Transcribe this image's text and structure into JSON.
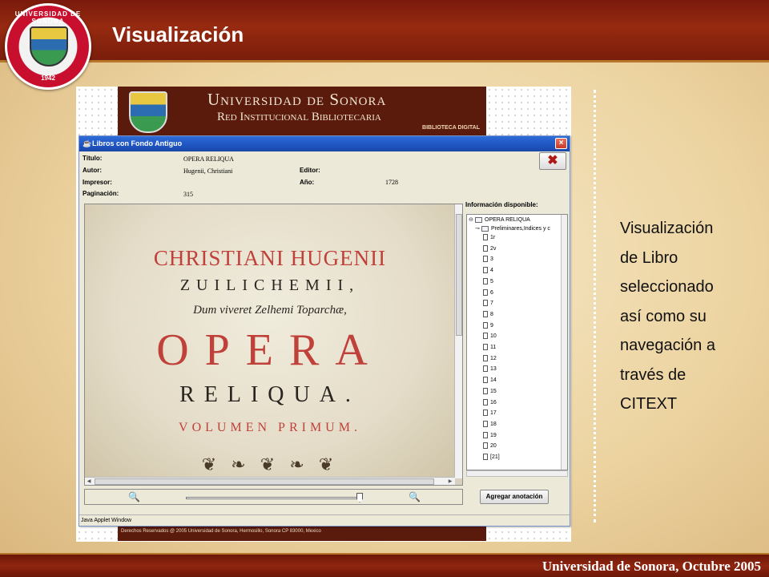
{
  "slide": {
    "title": "Visualización",
    "footer": "Universidad de Sonora, Octubre 2005",
    "seal_top": "UNIVERSIDAD DE SONORA",
    "seal_year": "1942",
    "caption_lines": [
      "Visualización",
      "de Libro",
      "seleccionado",
      "así como su",
      "navegación a",
      "través de",
      "CITEXT"
    ]
  },
  "banner": {
    "title": "Universidad de Sonora",
    "subtitle": "Red Institucional Bibliotecaria",
    "badge": "BIBLIOTECA DIGITAL",
    "copyright": "Derechos Reservados @ 2005 Universidad de Sonora, Hermosillo, Sonora CP 83000, Mexico"
  },
  "applet": {
    "window_title": "Libros con Fondo Antiguo",
    "status": "Java Applet Window",
    "close_glyph": "✖",
    "meta": {
      "titulo_label": "Título:",
      "titulo_value": "OPERA RELIQUA",
      "autor_label": "Autor:",
      "autor_value": "Hugenii, Christiani",
      "impresor_label": "Impresor:",
      "paginacion_label": "Paginación:",
      "paginacion_value": "315",
      "editor_label": "Editor:",
      "anio_label": "Año:",
      "anio_value": "1728"
    },
    "info_label": "Información disponible:",
    "annotate_button": "Agregar anotación"
  },
  "book": {
    "lines": [
      "CHRISTIANI HUGENII",
      "ZUILICHEMII,",
      "Dum viveret Zelhemi Toparchæ,",
      "OPERA",
      "RELIQUA.",
      "VOLUMEN PRIMUM."
    ]
  },
  "tree": {
    "root": "OPERA RELIQUA",
    "folder": "Preliminares,Indices y c",
    "pages": [
      "1r",
      "2v",
      "3",
      "4",
      "5",
      "6",
      "7",
      "8",
      "9",
      "10",
      "11",
      "12",
      "13",
      "14",
      "15",
      "16",
      "17",
      "18",
      "19",
      "20",
      "[21]"
    ]
  },
  "colors": {
    "header": "#8a2410",
    "book_red": "#c0403a",
    "book_black": "#2a2420"
  }
}
